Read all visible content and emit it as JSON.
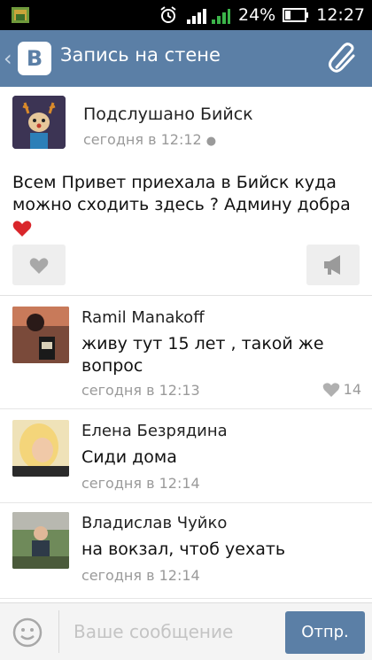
{
  "status_bar": {
    "battery": "24%",
    "time": "12:27"
  },
  "app_bar": {
    "logo_letter": "В",
    "title": "Запись на стене"
  },
  "post": {
    "author": "Подслушано Бийск",
    "time": "сегодня в 12:12",
    "text": "Всем Привет приехала в Бийск куда можно сходить здесь ?  Админу добра"
  },
  "comments": [
    {
      "name": "Ramil Manakoff",
      "text": "живу тут 15 лет , такой же вопрос",
      "time": "сегодня в 12:13",
      "likes": "14"
    },
    {
      "name": "Елена Безрядина",
      "text": "Сиди дома",
      "time": "сегодня в 12:14"
    },
    {
      "name": "Владислав Чуйко",
      "text": "на вокзал, чтоб уехать",
      "time": "сегодня в 12:14"
    }
  ],
  "input": {
    "placeholder": "Ваше сообщение",
    "send_label": "Отпр."
  },
  "colors": {
    "accent": "#5b7fa6",
    "status_bar": "#000000",
    "muted_text": "#9a9a9a"
  }
}
